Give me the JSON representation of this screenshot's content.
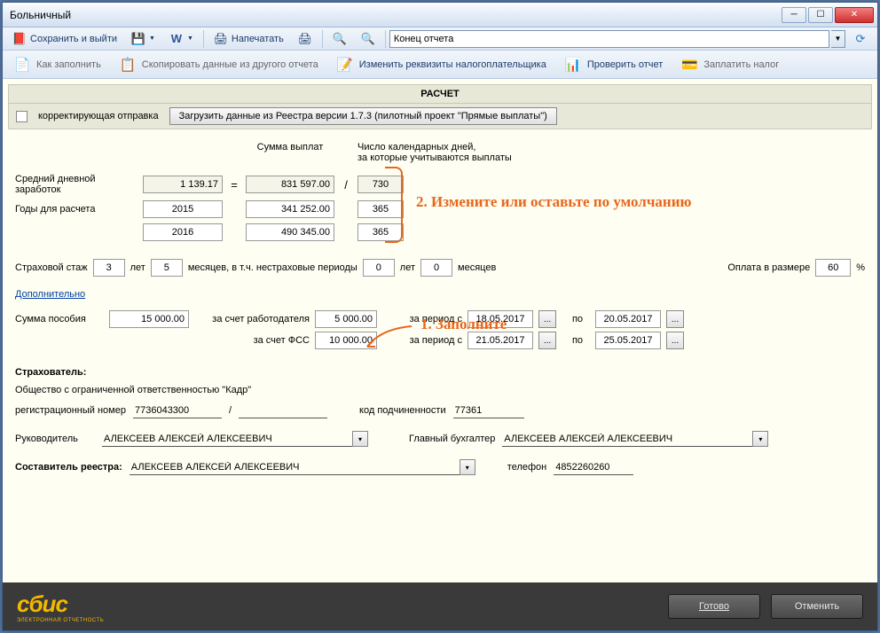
{
  "window": {
    "title": "Больничный"
  },
  "toolbar1": {
    "save_exit": "Сохранить и выйти",
    "print": "Напечатать",
    "combo_value": "Конец отчета"
  },
  "toolbar2": {
    "how_fill": "Как заполнить",
    "copy_data": "Скопировать данные из другого отчета",
    "change_req": "Изменить реквизиты налогоплательщика",
    "check_report": "Проверить отчет",
    "pay_tax": "Заплатить налог"
  },
  "section": {
    "title": "РАСЧЕТ"
  },
  "correction": {
    "label": "корректирующая отправка"
  },
  "load_btn": "Загрузить данные из Реестра версии 1.7.3 (пилотный проект \"Прямые выплаты\")",
  "headers": {
    "sum_pay": "Сумма выплат",
    "days": "Число календарных дней,\nза которые учитываются выплаты"
  },
  "calc": {
    "avg_label": "Средний дневной заработок",
    "avg_value": "1 139.17",
    "total_sum": "831 597.00",
    "total_days": "730",
    "years_label": "Годы для расчета",
    "year1": "2015",
    "sum1": "341 252.00",
    "days1": "365",
    "year2": "2016",
    "sum2": "490 345.00",
    "days2": "365"
  },
  "annotations": {
    "step2": "2. Измените или оставьте по умолчанию",
    "step1": "1. Заполните"
  },
  "stazh": {
    "label": "Страховой стаж",
    "years": "3",
    "years_lbl": "лет",
    "months": "5",
    "months_lbl": "месяцев, в т.ч. нестраховые периоды",
    "ns_years": "0",
    "ns_years_lbl": "лет",
    "ns_months": "0",
    "ns_months_lbl": "месяцев",
    "pay_label": "Оплата в размере",
    "pay_pct": "60",
    "pct_sign": "%"
  },
  "more_link": "Дополнительно",
  "benefit": {
    "sum_label": "Сумма пособия",
    "sum": "15 000.00",
    "emp_label": "за счет работодателя",
    "emp_sum": "5 000.00",
    "period_from_lbl": "за период с",
    "emp_from": "18.05.2017",
    "to_lbl": "по",
    "emp_to": "20.05.2017",
    "fss_label": "за счет ФСС",
    "fss_sum": "10 000.00",
    "fss_from": "21.05.2017",
    "fss_to": "25.05.2017"
  },
  "insurer": {
    "title": "Страхователь:",
    "org": "Общество с ограниченной ответственностью \"Кадр\"",
    "reg_lbl": "регистрационный номер",
    "reg1": "7736043300",
    "slash": "/",
    "sub_lbl": "код подчиненности",
    "sub_code": "77361",
    "head_lbl": "Руководитель",
    "head": "АЛЕКСЕЕВ АЛЕКСЕЙ АЛЕКСЕЕВИЧ",
    "acc_lbl": "Главный бухгалтер",
    "acc": "АЛЕКСЕЕВ АЛЕКСЕЙ АЛЕКСЕЕВИЧ",
    "author_lbl": "Составитель реестра:",
    "author": "АЛЕКСЕЕВ АЛЕКСЕЙ АЛЕКСЕЕВИЧ",
    "phone_lbl": "телефон",
    "phone": "4852260260"
  },
  "footer": {
    "ready": "Готово",
    "cancel": "Отменить"
  }
}
